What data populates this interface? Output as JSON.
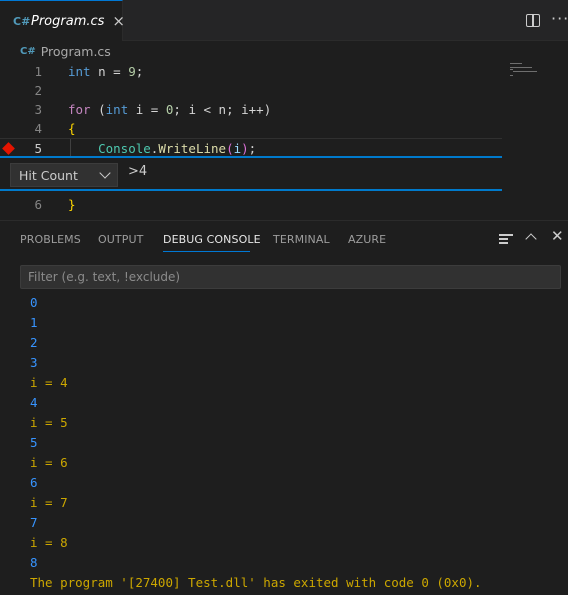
{
  "tab": {
    "icon": "csharp-file-icon",
    "title": "Program.cs",
    "close": "×"
  },
  "actions": {
    "split": "split-editor-icon",
    "more": "···"
  },
  "breadcrumb": {
    "icon": "csharp-file-icon",
    "file": "Program.cs"
  },
  "editor": {
    "lines": [
      {
        "number": "1"
      },
      {
        "number": "2"
      },
      {
        "number": "3"
      },
      {
        "number": "4"
      },
      {
        "number": "5",
        "breakpoint": true
      },
      {
        "number": "6"
      }
    ],
    "code": {
      "l1": {
        "kw": "int",
        "rest": " n = ",
        "num": "9",
        "end": ";"
      },
      "l3": {
        "for": "for",
        "open": " (",
        "int": "int",
        "decl": " i = ",
        "zero": "0",
        "cond": "; i < n; i++)"
      },
      "l4": {
        "brace": "{"
      },
      "l5": {
        "indent": "    ",
        "cls": "Console",
        "dot": ".",
        "fn": "WriteLine",
        "lp": "(",
        "arg": "i",
        "rp": ")",
        "end": ";"
      },
      "l6": {
        "brace": "}"
      }
    }
  },
  "breakpoint_widget": {
    "type": "Hit Count",
    "condition": ">4"
  },
  "panel": {
    "tabs": [
      "PROBLEMS",
      "OUTPUT",
      "DEBUG CONSOLE",
      "TERMINAL",
      "AZURE"
    ],
    "active_tab": "DEBUG CONSOLE",
    "filter_placeholder": "Filter (e.g. text, !exclude)",
    "icons": {
      "clear": "clear-console-icon",
      "maximize": "chevron-up-icon",
      "close": "close-icon"
    }
  },
  "console_output": [
    {
      "text": "0",
      "color": "blue"
    },
    {
      "text": "1",
      "color": "blue"
    },
    {
      "text": "2",
      "color": "blue"
    },
    {
      "text": "3",
      "color": "blue"
    },
    {
      "text": "i = 4",
      "color": "orange"
    },
    {
      "text": "4",
      "color": "blue"
    },
    {
      "text": "i = 5",
      "color": "orange"
    },
    {
      "text": "5",
      "color": "blue"
    },
    {
      "text": "i = 6",
      "color": "orange"
    },
    {
      "text": "6",
      "color": "blue"
    },
    {
      "text": "i = 7",
      "color": "orange"
    },
    {
      "text": "7",
      "color": "blue"
    },
    {
      "text": "i = 8",
      "color": "orange"
    },
    {
      "text": "8",
      "color": "blue"
    },
    {
      "text": "The program '[27400] Test.dll' has exited with code 0 (0x0).",
      "color": "orange"
    }
  ],
  "colors": {
    "accent": "#0078d4",
    "breakpoint": "#e51400",
    "stdout": "#3794ff",
    "logpoint": "#cca700"
  }
}
